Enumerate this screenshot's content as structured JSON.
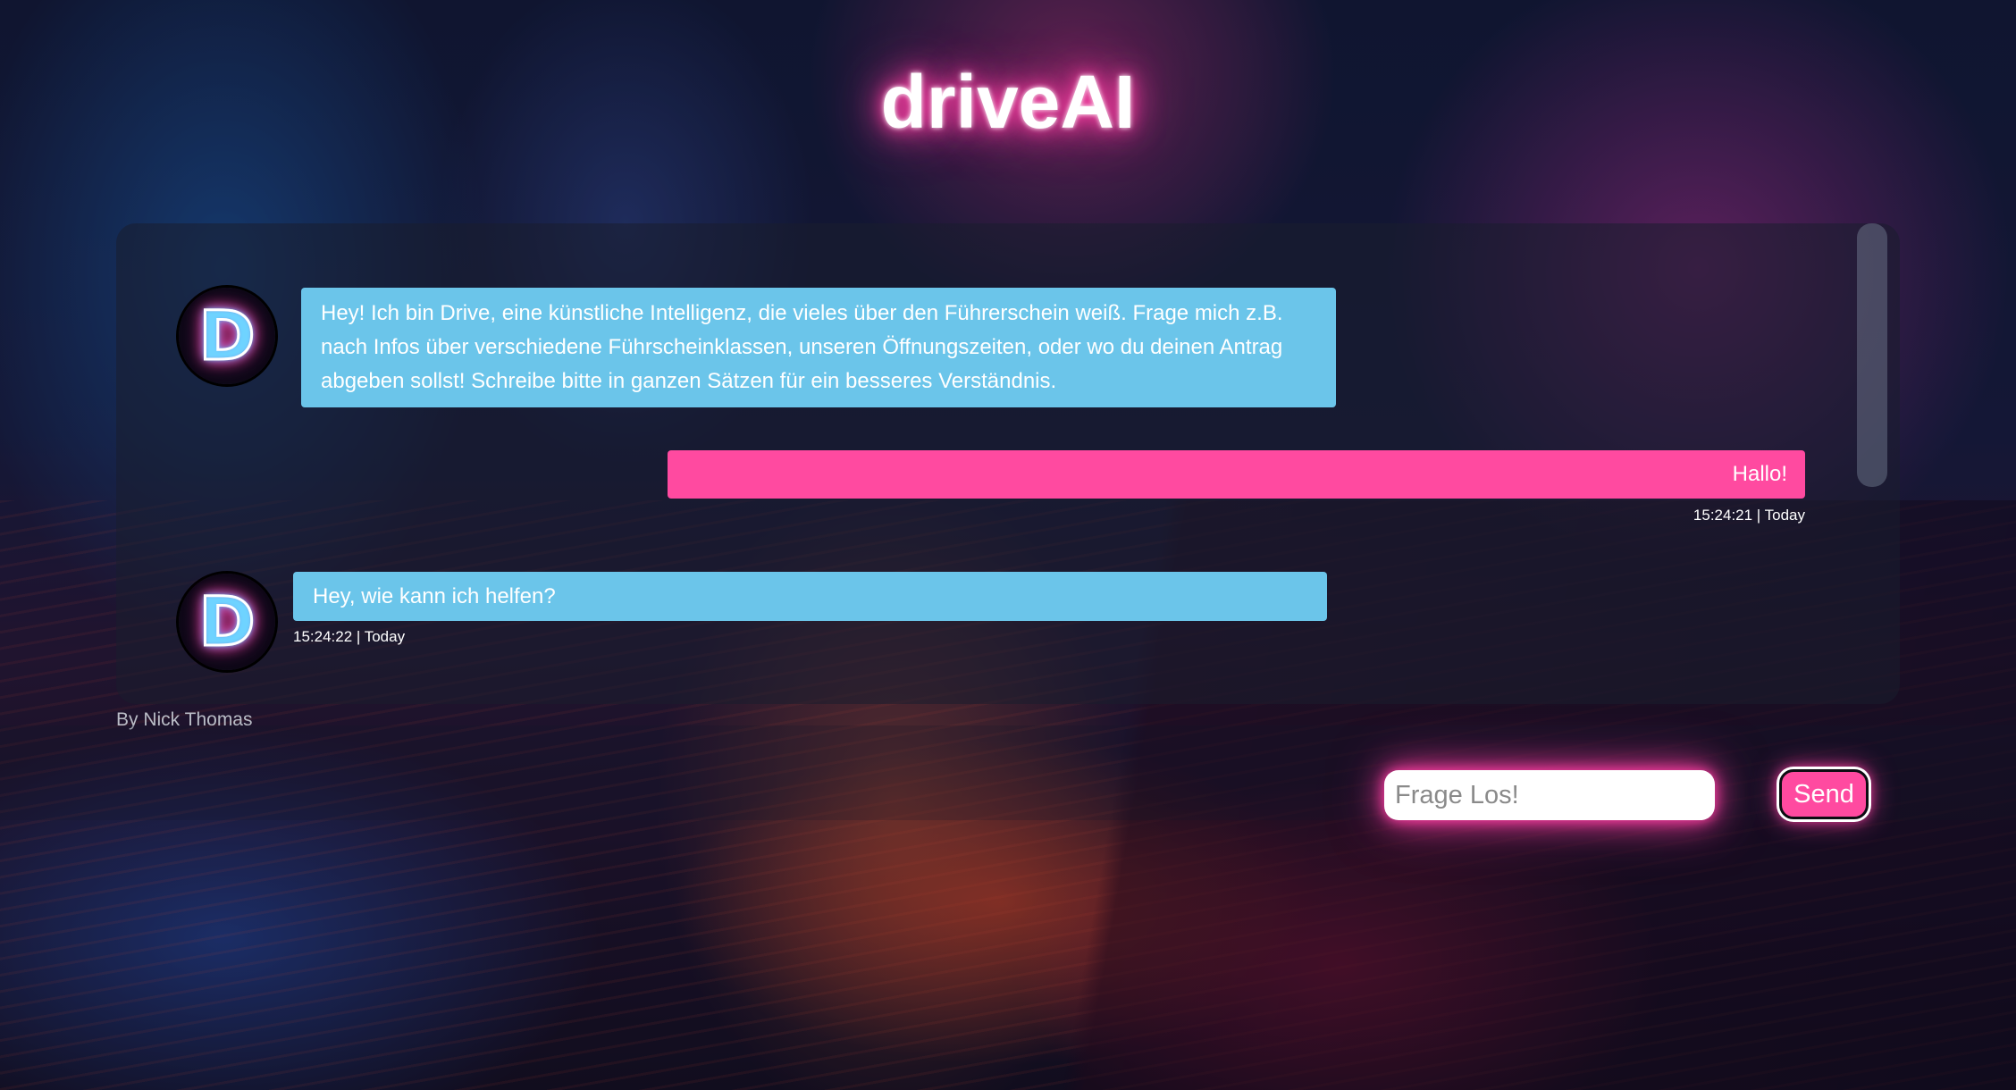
{
  "app": {
    "title": "driveAI",
    "author": "By Nick Thomas"
  },
  "colors": {
    "bot_bubble": "#6bc5ea",
    "user_bubble": "#ff4aa0",
    "accent_glow": "#ff3fa4"
  },
  "messages": [
    {
      "sender": "bot",
      "avatar_letter": "D",
      "avatar_icon": "driveai-logo-icon",
      "text": "Hey! Ich bin Drive, eine künstliche Intelligenz, die vieles über den Führerschein weiß. Frage mich z.B. nach Infos über verschiedene Führscheinklassen, unseren Öffnungszeiten, oder wo du deinen Antrag abgeben sollst! Schreibe bitte in ganzen Sätzen für ein besseres Verständnis.",
      "timestamp": ""
    },
    {
      "sender": "user",
      "text": "Hallo!",
      "timestamp": "15:24:21 | Today"
    },
    {
      "sender": "bot",
      "avatar_letter": "D",
      "avatar_icon": "driveai-logo-icon",
      "text": "Hey, wie kann ich helfen?",
      "timestamp": "15:24:22 | Today"
    }
  ],
  "input": {
    "placeholder": "Frage Los!",
    "value": "",
    "send_label": "Send"
  }
}
